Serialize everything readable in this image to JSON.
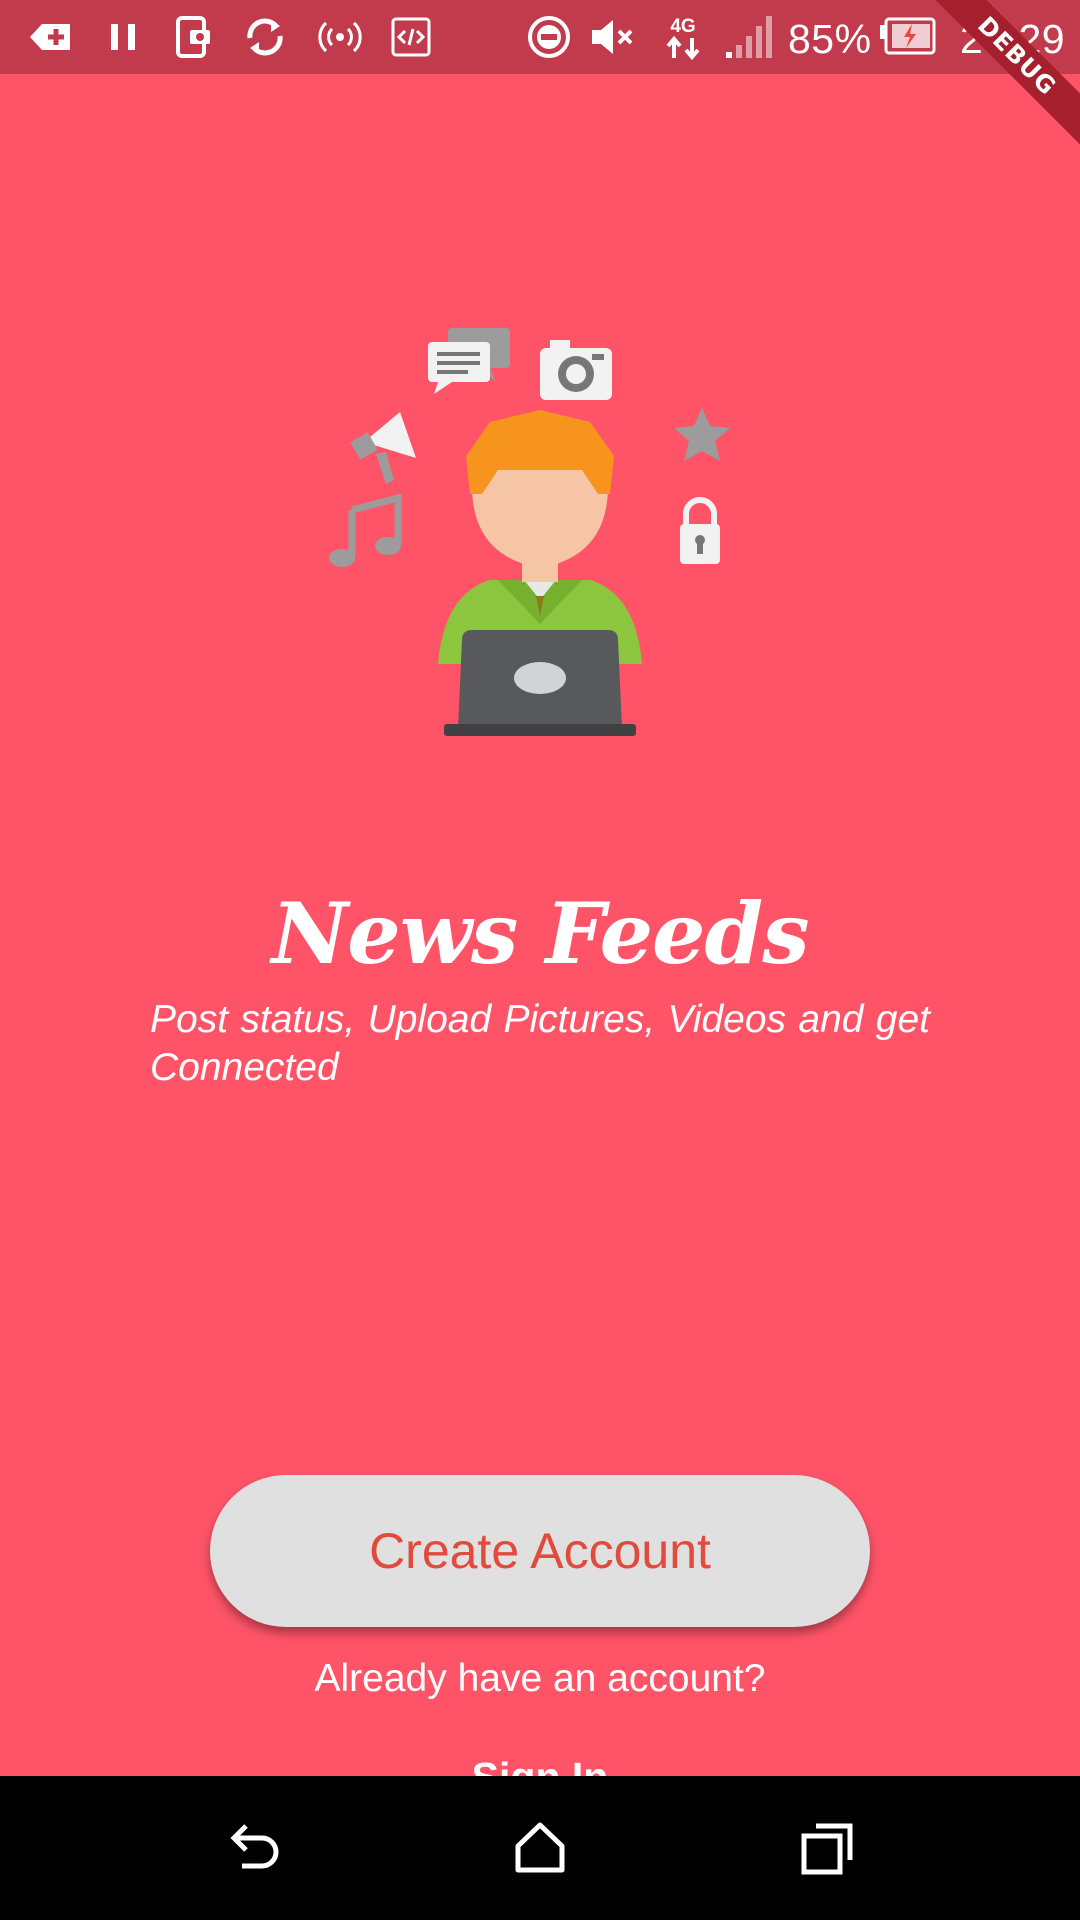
{
  "status_bar": {
    "battery_percent": "85%",
    "network_type": "4G",
    "time": "20:29",
    "icons": [
      "add-icon",
      "pause-icon",
      "screenshot-icon",
      "sync-icon",
      "hotspot-icon",
      "code-icon",
      "do-not-disturb-icon",
      "mute-icon",
      "network-4g-icon",
      "signal-icon",
      "battery-charging-icon"
    ]
  },
  "debug_banner": "DEBUG",
  "welcome": {
    "title": "News Feeds",
    "subtitle": "Post status, Upload Pictures, Videos and get Connected",
    "illustration_icons": [
      "chat-icon",
      "camera-icon",
      "megaphone-icon",
      "star-icon",
      "music-icon",
      "lock-icon"
    ]
  },
  "actions": {
    "create_account_label": "Create Account",
    "already_text": "Already have an account?",
    "sign_in_label": "Sign In"
  },
  "nav_bar": {
    "icons": [
      "back-icon",
      "home-icon",
      "recents-icon"
    ]
  },
  "colors": {
    "background": "#ff5468",
    "status_bar": "#c13b4d",
    "button_background": "#e0e0e0",
    "button_text": "#e14b3c",
    "nav_bar": "#000000"
  }
}
